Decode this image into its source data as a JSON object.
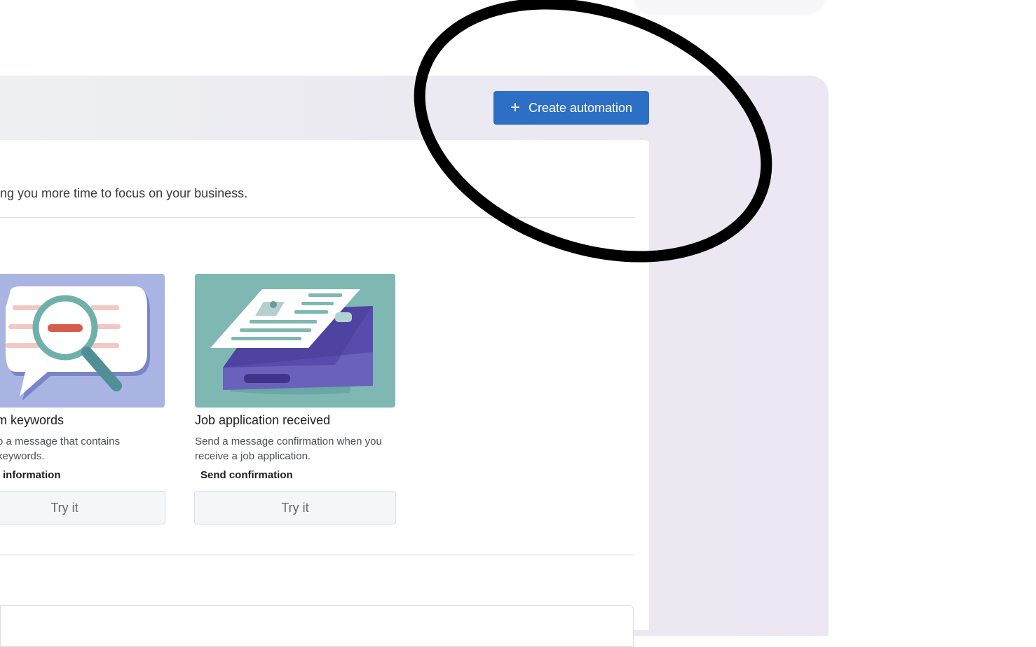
{
  "header": {
    "create_button_label": "Create automation",
    "create_button_icon": "plus-icon",
    "accent_color": "#2d6fc4"
  },
  "main": {
    "description": "ng you more time to focus on your business.",
    "templates": [
      {
        "title": "m keywords",
        "description_line1": "o a message that contains",
        "description_line2": "keywords.",
        "action": "information",
        "button_label": "Try it",
        "illustration": "speech-bubble-magnifier-illustration"
      },
      {
        "title": "Job application received",
        "description_line1": "Send a message confirmation when you",
        "description_line2": "receive a job application.",
        "action": "Send confirmation",
        "button_label": "Try it",
        "illustration": "job-application-illustration"
      }
    ]
  }
}
